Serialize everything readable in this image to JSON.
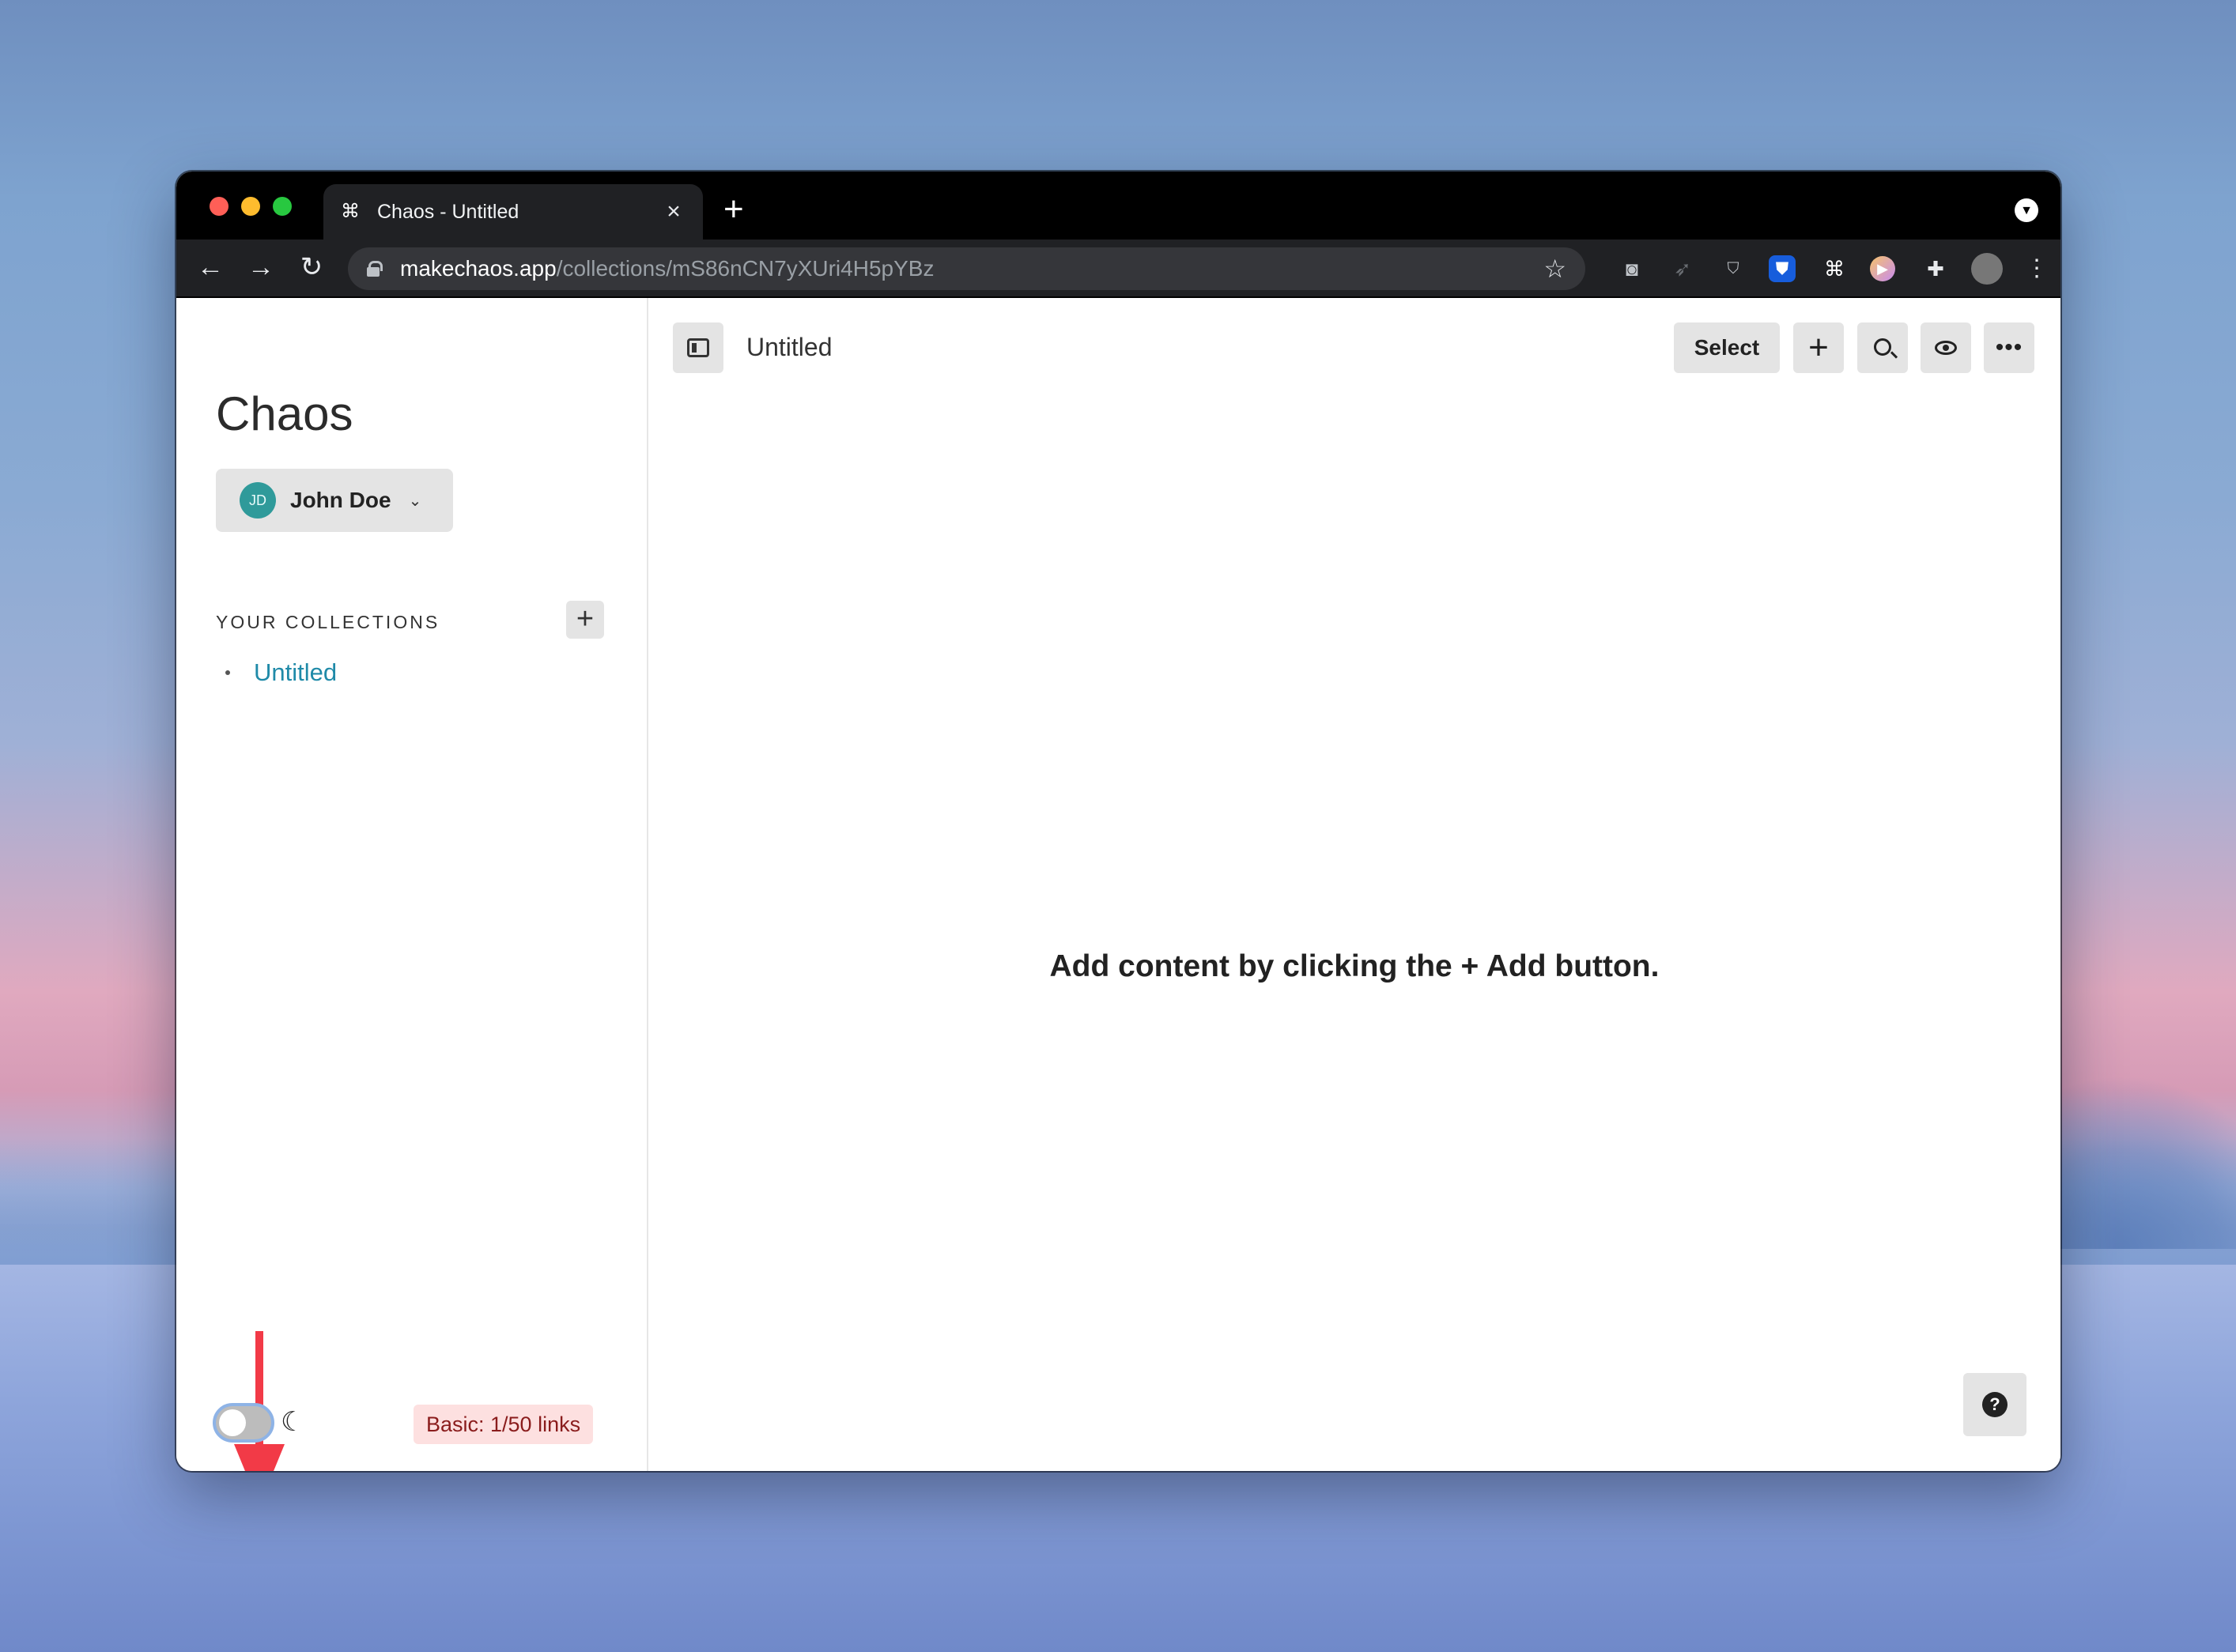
{
  "browser": {
    "tab_title": "Chaos - Untitled",
    "tab_favicon": "chaos-logo-icon",
    "url_host": "makechaos.app",
    "url_path": "/collections/mS86nCN7yXUri4H5pYBz",
    "extensions": [
      "camera-icon",
      "rocket-icon",
      "ublock-icon",
      "bitwarden-icon",
      "chaos-extension-icon",
      "media-player-icon",
      "puzzle-icon",
      "profile-avatar-icon",
      "kebab-menu-icon"
    ]
  },
  "sidebar": {
    "app_title": "Chaos",
    "user": {
      "initials": "JD",
      "name": "John Doe"
    },
    "collections_heading": "YOUR COLLECTIONS",
    "collections": [
      {
        "label": "Untitled"
      }
    ],
    "plan_badge": "Basic: 1/50 links",
    "dark_mode_enabled": false
  },
  "main": {
    "title": "Untitled",
    "select_label": "Select",
    "empty_message": "Add content by clicking the + Add button."
  },
  "annotation": {
    "color": "#f23a47",
    "icon": "red-arrow-down"
  },
  "colors": {
    "link": "#1f8aa8",
    "avatar": "#2f9a9a",
    "badge_bg": "#fde0e0",
    "badge_text": "#8a1c1c"
  }
}
